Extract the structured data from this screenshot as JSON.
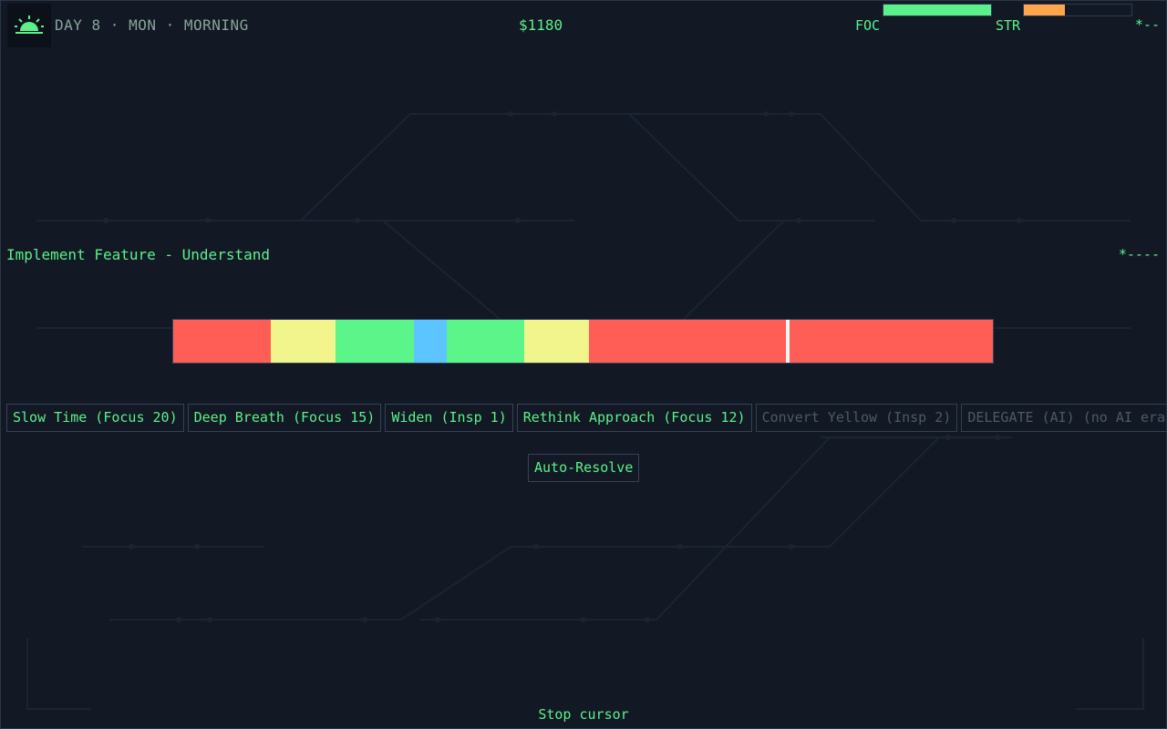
{
  "header": {
    "day_text": "DAY 8 · MON · MORNING",
    "money": "$1180",
    "focus_label": "FOC",
    "focus_level": 1.0,
    "stress_label": "STR",
    "stress_level": 0.38,
    "indicator": "*--"
  },
  "task": {
    "title": "Implement Feature - Understand",
    "progress_indicator": "*----"
  },
  "timeline": {
    "segments": [
      {
        "color": "#ff5e57",
        "share": 107
      },
      {
        "color": "#f2f58c",
        "share": 71
      },
      {
        "color": "#5cf58a",
        "share": 86
      },
      {
        "color": "#5cc4ff",
        "share": 36
      },
      {
        "color": "#5cf58a",
        "share": 85
      },
      {
        "color": "#f2f58c",
        "share": 71
      },
      {
        "color": "#ff5e57",
        "share": 443
      }
    ],
    "cursor_position": 0.75
  },
  "actions": [
    {
      "label": "Slow Time (Focus 20)",
      "enabled": true
    },
    {
      "label": "Deep Breath (Focus 15)",
      "enabled": true
    },
    {
      "label": "Widen (Insp 1)",
      "enabled": true
    },
    {
      "label": "Rethink Approach (Focus 12)",
      "enabled": true
    },
    {
      "label": "Convert Yellow (Insp 2)",
      "enabled": false
    },
    {
      "label": "DELEGATE (AI) (no AI era)",
      "enabled": false
    }
  ],
  "auto_resolve_label": "Auto-Resolve",
  "footer_hint": "Stop cursor",
  "colors": {
    "accent": "#5cf08a",
    "focus_bar": "#5cf08a",
    "stress_bar": "#ffa64d",
    "background": "#121925"
  },
  "icons": {
    "time_of_day": "sunrise-icon"
  }
}
